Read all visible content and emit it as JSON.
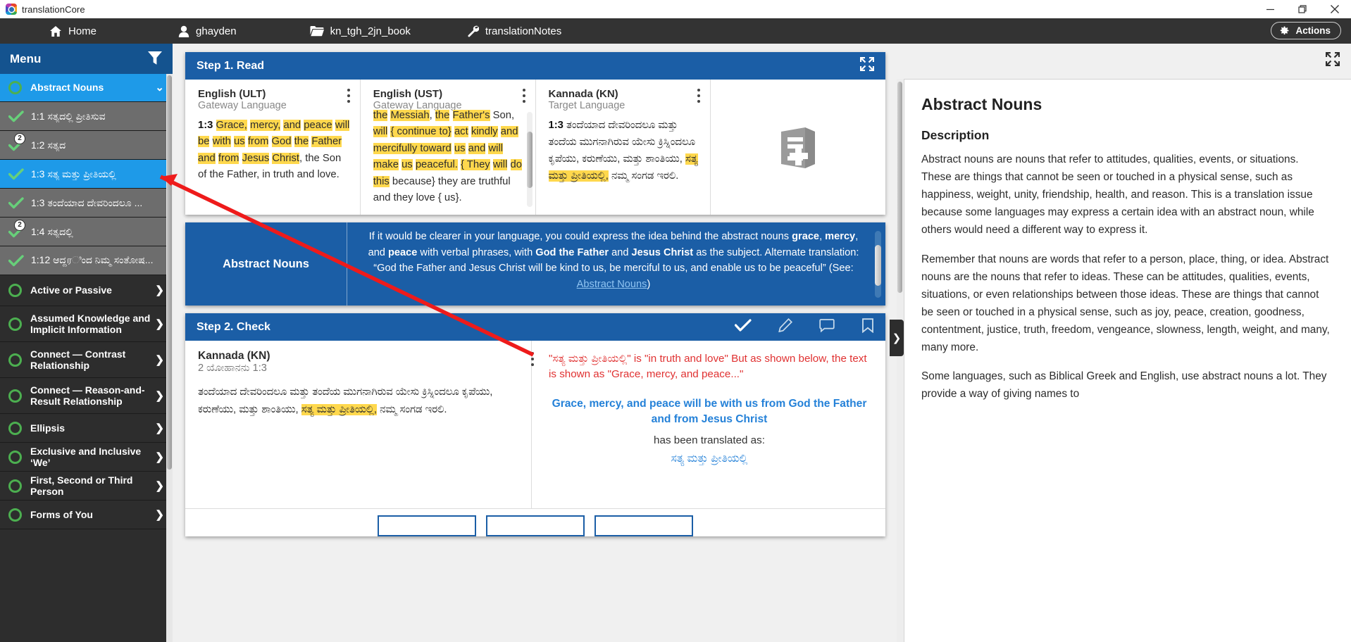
{
  "window": {
    "title": "translationCore",
    "controls": {
      "minimize": "minimize-icon",
      "maximize": "maximize-icon",
      "close": "close-icon"
    }
  },
  "nav": {
    "items": [
      {
        "label": "Home",
        "icon": "home-icon"
      },
      {
        "label": "ghayden",
        "icon": "user-icon"
      },
      {
        "label": "kn_tgh_2jn_book",
        "icon": "folder-icon"
      },
      {
        "label": "translationNotes",
        "icon": "wrench-icon"
      }
    ],
    "actions_label": "Actions",
    "actions_icon": "gear-icon"
  },
  "sidebar": {
    "header": {
      "title": "Menu",
      "filter_icon": "filter-icon"
    },
    "group": {
      "label": "Abstract Nouns",
      "status": "circle-open",
      "chevron": "chevron-down-icon"
    },
    "items": [
      {
        "label": "1:1 ಸತ್ಯದಲ್ಲಿ ಪ್ರೀತಿಸುವ",
        "state": "done",
        "badge": "",
        "active": false
      },
      {
        "label": "1:2 ಸತ್ಯದ",
        "state": "done",
        "badge": "2",
        "active": false
      },
      {
        "label": "1:3 ಸತ್ಯ ಮತ್ತು ಪ್ರೀತಿಯಲ್ಲಿ",
        "state": "done",
        "badge": "",
        "active": true
      },
      {
        "label": "1:3 ತಂದೆಯಾದ ದೇವರಿಂದಲೂ ...",
        "state": "done",
        "badge": "",
        "active": false
      },
      {
        "label": "1:4 ಸತ್ಯದಲ್ಲಿ",
        "state": "done",
        "badge": "2",
        "active": false
      },
      {
        "label": "1:12 ಆದ್ದரಿಂದ ನಿಮ್ಮ ಸಂತೋಷ...",
        "state": "done",
        "badge": "",
        "active": false
      }
    ],
    "groups": [
      {
        "label": "Active or Passive",
        "chevron": "chevron-right-icon"
      },
      {
        "label": "Assumed Knowledge and Implicit Information",
        "chevron": "chevron-right-icon"
      },
      {
        "label": "Connect — Contrast Relationship",
        "chevron": "chevron-right-icon"
      },
      {
        "label": "Connect — Reason-and-Result Relationship",
        "chevron": "chevron-right-icon"
      },
      {
        "label": "Ellipsis",
        "chevron": "chevron-right-icon"
      },
      {
        "label": "Exclusive and Inclusive ‘We’",
        "chevron": "chevron-right-icon"
      },
      {
        "label": "First, Second or Third Person",
        "chevron": "chevron-right-icon"
      },
      {
        "label": "Forms of You",
        "chevron": "chevron-right-icon"
      }
    ]
  },
  "step1": {
    "title": "Step 1. Read",
    "expand_icon": "expand-icon",
    "panes": [
      {
        "title": "English (ULT)",
        "subtitle": "Gateway Language",
        "ref": "1:3",
        "menu_icon": "kebab-menu-icon"
      },
      {
        "title": "English (UST)",
        "subtitle": "Gateway Language",
        "menu_icon": "kebab-menu-icon"
      },
      {
        "title": "Kannada (KN)",
        "subtitle": "Target Language",
        "ref": "1:3",
        "menu_icon": "kebab-menu-icon"
      }
    ],
    "ult_text_plain": "1:3 Grace, mercy, and peace will be with us from God the Father and from Jesus Christ, the Son of the Father, in truth and love.",
    "ust_text_plain": "the Messiah, the Father's Son, will { continue to} act kindly and mercifully toward us and will make us peaceful. { They will do this because} they are truthful and they love { us}.",
    "kn_text_plain": "1:3 ತಂದೆಯಾದ ದೇವರಿಂದಲೂ ಮತ್ತು ತಂದೆಯ ಮುಗನಾಗಿರುವ ಯೇಸು ಕ್ರಿಸ್ನಿಂದಲೂ ಕೃಪೆಯು, ಕರುಣೆಯು, ಮತ್ತು ಶಾಂತಿಯು, ಸತ್ಯ ಮತ್ತು ಪ್ರೀತಿಯಲ್ಲಿ, ನಮ್ಮ ಸಂಗಡ ಇರಲಿ.",
    "book_icon": "book-add-icon"
  },
  "note": {
    "title": "Abstract Nouns",
    "body_prefix": "If it would be clearer in your language, you could express the idea behind the abstract nouns ",
    "word1": "grace",
    "sep1": ", ",
    "word2": "mercy",
    "sep2": ", and ",
    "word3": "peace",
    "mid": " with verbal phrases, with ",
    "subject1": "God the Father",
    "and": " and ",
    "subject2": "Jesus Christ",
    "tail": " as the subject. Alternate translation: “God the Father and Jesus Christ will be kind to us, be merciful to us, and enable us to be peaceful” (See: ",
    "link": "Abstract Nouns",
    "tail2": ")"
  },
  "step2": {
    "title": "Step 2. Check",
    "icons": [
      "check-icon",
      "pencil-icon",
      "comment-icon",
      "bookmark-icon"
    ],
    "left": {
      "lang": "Kannada (KN)",
      "reference": "2 ಯೋಹಾನನು 1:3",
      "text_plain": "ತಂದೆಯಾದ ದೇವರಿಂದಲೂ ಮತ್ತು ತಂದೆಯ ಮುಗನಾಗಿರುವ ಯೇಸು ಕ್ರಿಸ್ನಿಂದಲೂ ಕೃಪೆಯು, ಕರುಣೆಯು, ಮತ್ತು ಶಾಂತಿಯು, ಸತ್ಯ ಮತ್ತು ಪ್ರೀತಿಯಲ್ಲಿ, ನಮ್ಮ ಸಂಗಡ ಇರಲಿ.",
      "menu_icon": "kebab-menu-icon"
    },
    "right": {
      "warning": "\"ಸತ್ಯ ಮತ್ತು ಪ್ರೀತಿಯಲ್ಲಿ\" is \"in truth and love\" But as shown below, the text is shown as \"Grace, mercy, and peace...\"",
      "phrase": "Grace, mercy, and peace will be with us from God the Father and from Jesus Christ",
      "translated_label": "has been translated as:",
      "translated_value": "ಸತ್ಯ ಮತ್ತು ಪ್ರೀತಿಯಲ್ಲಿ"
    }
  },
  "rightpanel": {
    "expand_icon": "expand-icon",
    "drawer_icon": "chevron-right-icon",
    "title": "Abstract Nouns",
    "heading": "Description",
    "paragraphs": [
      "Abstract nouns are nouns that refer to attitudes, qualities, events, or situations. These are things that cannot be seen or touched in a physical sense, such as happiness, weight, unity, friendship, health, and reason. This is a translation issue because some languages may express a certain idea with an abstract noun, while others would need a different way to express it.",
      "Remember that nouns are words that refer to a person, place, thing, or idea. Abstract nouns are the nouns that refer to ideas. These can be attitudes, qualities, events, situations, or even relationships between those ideas. These are things that cannot be seen or touched in a physical sense, such as joy, peace, creation, goodness, contentment, justice, truth, freedom, vengeance, slowness, length, weight, and many, many more.",
      "Some languages, such as Biblical Greek and English, use abstract nouns a lot. They provide a way of giving names to"
    ]
  },
  "colors": {
    "nav_bg": "#333333",
    "accent_blue": "#1b5ea6",
    "menu_header": "#14538f",
    "highlight_blue": "#1e9ae8",
    "yellow_highlight": "#ffd84d",
    "green_check": "#4caf50",
    "warn_red": "#e03131",
    "link_blue": "#2481d8",
    "annotation_red": "#ee1b1b"
  }
}
